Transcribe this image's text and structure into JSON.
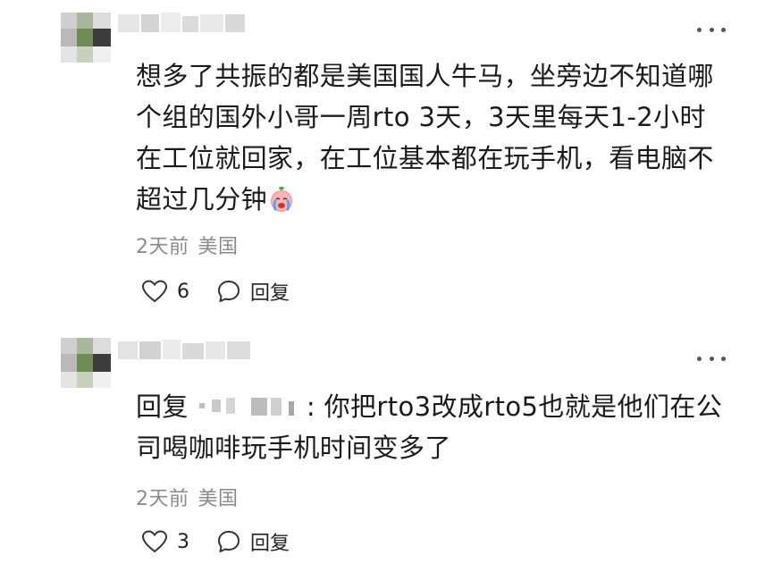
{
  "comments": [
    {
      "text": "想多了共振的都是美国国人牛马，坐旁边不知道哪个组的国外小哥一周rto 3天，3天里每天1-2小时在工位就回家，在工位基本都在玩手机，看电脑不超过几分钟",
      "emoji": "crying-face-emoji",
      "time": "2天前",
      "location": "美国",
      "likes": "6",
      "reply_label": "回复"
    },
    {
      "reply_prefix": "回复",
      "text": ": 你把rto3改成rto5也就是他们在公司喝咖啡玩手机时间变多了",
      "time": "2天前",
      "location": "美国",
      "likes": "3",
      "reply_label": "回复"
    }
  ],
  "icons": {
    "like": "heart-outline-icon",
    "reply": "speech-bubble-icon",
    "more": "more-dots-icon"
  }
}
